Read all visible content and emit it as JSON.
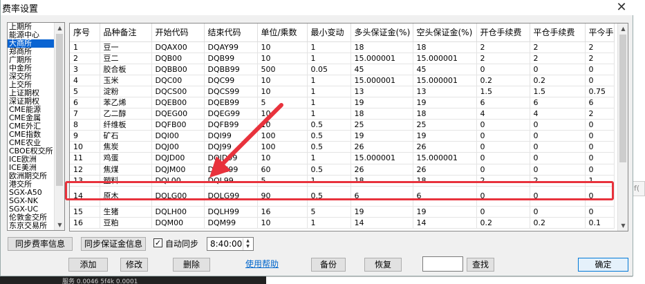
{
  "window": {
    "title": "费率设置",
    "close_glyph": "✕"
  },
  "background": {
    "text": "服务 0.0046 5f4k 0.0001"
  },
  "exchanges": {
    "items": [
      "上期所",
      "能源中心",
      "大商所",
      "郑商所",
      "广期所",
      "中金所",
      "深交所",
      "上交所",
      "上证期权",
      "深证期权",
      "CME能源",
      "CME金属",
      "CME外汇",
      "CME指数",
      "CME农业",
      "CBOE权交所",
      "ICE欧洲",
      "ICE美洲",
      "欧洲期交所",
      "港交所",
      "SGX-A50",
      "SGX-NK",
      "SGX-UC",
      "伦敦金交所",
      "东京交易所"
    ],
    "selected_index": 2
  },
  "table": {
    "columns": [
      "序号",
      "品种备注",
      "开始代码",
      "结束代码",
      "单位/乘数",
      "最小变动",
      "多头保证金(%)",
      "空头保证金(%)",
      "开仓手续费",
      "平仓手续费",
      "平今手"
    ],
    "rows": [
      [
        "1",
        "豆一",
        "DQAX00",
        "DQAY99",
        "10",
        "1",
        "18",
        "18",
        "2",
        "2",
        "2"
      ],
      [
        "2",
        "豆二",
        "DQB00",
        "DQB99",
        "10",
        "1",
        "15.000001",
        "15.000001",
        "2",
        "2",
        "2"
      ],
      [
        "3",
        "胶合板",
        "DQBB00",
        "DQBB99",
        "500",
        "0.05",
        "45",
        "45",
        "0",
        "0",
        "0"
      ],
      [
        "4",
        "玉米",
        "DQC00",
        "DQC99",
        "10",
        "1",
        "15.000001",
        "15.000001",
        "0.2",
        "0.2",
        "0"
      ],
      [
        "5",
        "淀粉",
        "DQCS00",
        "DQCS99",
        "10",
        "1",
        "13",
        "13",
        "1.5",
        "1.5",
        "0.75"
      ],
      [
        "6",
        "苯乙烯",
        "DQEB00",
        "DQEB99",
        "5",
        "1",
        "19",
        "19",
        "6",
        "6",
        "6"
      ],
      [
        "7",
        "乙二醇",
        "DQEG00",
        "DQEG99",
        "10",
        "1",
        "18",
        "18",
        "4",
        "4",
        "2"
      ],
      [
        "8",
        "纤维板",
        "DQFB00",
        "DQFB99",
        "10",
        "0.5",
        "25",
        "25",
        "0",
        "0",
        "0"
      ],
      [
        "9",
        "矿石",
        "DQI00",
        "DQI99",
        "100",
        "0.5",
        "19",
        "19",
        "0",
        "0",
        "0"
      ],
      [
        "10",
        "焦炭",
        "DQJ00",
        "DQJ99",
        "100",
        "0.5",
        "26",
        "26",
        "0",
        "0",
        "0"
      ],
      [
        "11",
        "鸡蛋",
        "DQJD00",
        "DQJD99",
        "10",
        "1",
        "15.000001",
        "15.000001",
        "0",
        "0",
        "0"
      ],
      [
        "12",
        "焦煤",
        "DQJM00",
        "DQJM99",
        "60",
        "0.5",
        "26",
        "26",
        "0",
        "0",
        "0"
      ],
      [
        "13",
        "塑料",
        "DQL00",
        "DQL99",
        "5",
        "1",
        "18",
        "18",
        "2",
        "2",
        "1"
      ],
      [
        "14",
        "原木",
        "DQLG00",
        "DQLG99",
        "90",
        "0.5",
        "6",
        "6",
        "0",
        "0",
        "0"
      ],
      [
        "15",
        "生猪",
        "DQLH00",
        "DQLH99",
        "16",
        "5",
        "19",
        "19",
        "0",
        "0",
        "0"
      ],
      [
        "16",
        "豆粕",
        "DQM00",
        "DQM99",
        "10",
        "1",
        "14",
        "14",
        "0.2",
        "0.2",
        "0.1"
      ]
    ],
    "highlighted_row": 14
  },
  "controls": {
    "sync_fee_label": "同步费率信息",
    "sync_margin_label": "同步保证金信息",
    "auto_sync_label": "自动同步",
    "auto_sync_checked": true,
    "sync_time": "8:40:00",
    "add_label": "添加",
    "edit_label": "修改",
    "delete_label": "删除",
    "help_label": "使用帮助",
    "backup_label": "备份",
    "restore_label": "恢复",
    "search_value": "",
    "search_label": "查找",
    "ok_label": "确定"
  },
  "colors": {
    "selection": "#0a64d2",
    "highlight_box": "#e8323c",
    "arrow": "#e8323c",
    "link": "#0066cc"
  }
}
